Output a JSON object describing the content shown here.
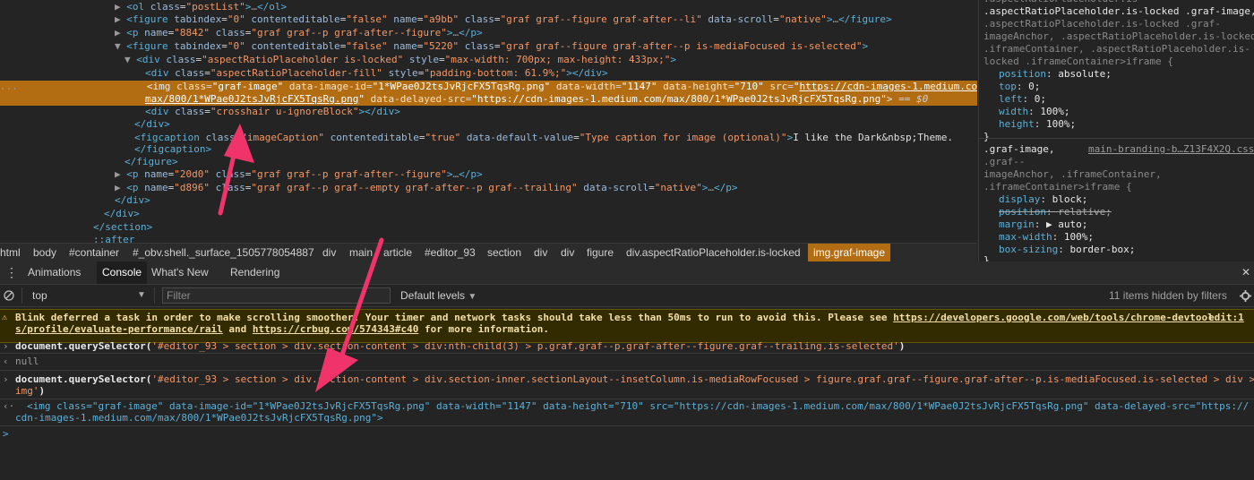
{
  "elements": {
    "lines": [
      {
        "indent": "        ",
        "arrow": "▶",
        "html": "<ol class=\"postList\">…</ol>"
      },
      {
        "indent": "        ",
        "arrow": "▶",
        "html": "<figure tabindex=\"0\" contenteditable=\"false\" name=\"a9bb\" class=\"graf graf--figure graf-after--li\" data-scroll=\"native\">…</figure>"
      },
      {
        "indent": "        ",
        "arrow": "▶",
        "html": "<p name=\"8842\" class=\"graf graf--p graf-after--figure\">…</p>"
      },
      {
        "indent": "        ",
        "arrow": "▼",
        "html": "<figure tabindex=\"0\" contenteditable=\"false\" name=\"5220\" class=\"graf graf--figure graf-after--p is-mediaFocused is-selected\">"
      },
      {
        "indent": "          ",
        "arrow": "▼",
        "html": "<div class=\"aspectRatioPlaceholder is-locked\" style=\"max-width: 700px; max-height: 433px;\">"
      },
      {
        "indent": "              ",
        "arrow": "",
        "html": "<div class=\"aspectRatioPlaceholder-fill\" style=\"padding-bottom: 61.9%;\"></div>"
      },
      {
        "indent": "              ",
        "arrow": "",
        "html": "<img class=\"graf-image\" data-image-id=\"1*WPae0J2tsJvRjcFX5TqsRg.png\" data-width=\"1147\" data-height=\"710\" src=\"https://cdn-images-1.medium.com/"
      },
      {
        "indent": "              ",
        "arrow": "",
        "html": "max/800/1*WPae0J2tsJvRjcFX5TqsRg.png\" data-delayed-src=\"https://cdn-images-1.medium.com/max/800/1*WPae0J2tsJvRjcFX5TqsRg.png\"> == $0"
      },
      {
        "indent": "              ",
        "arrow": "",
        "html": "<div class=\"crosshair u-ignoreBlock\"></div>"
      },
      {
        "indent": "            ",
        "arrow": "",
        "html": "</div>"
      },
      {
        "indent": "            ",
        "arrow": "",
        "html": "<figcaption class=\"imageCaption\" contenteditable=\"true\" data-default-value=\"Type caption for image (optional)\">I like the Dark&nbsp;Theme."
      },
      {
        "indent": "            ",
        "arrow": "",
        "html": "</figcaption>"
      },
      {
        "indent": "          ",
        "arrow": "",
        "html": "</figure>"
      },
      {
        "indent": "        ",
        "arrow": "▶",
        "html": "<p name=\"20d0\" class=\"graf graf--p graf-after--figure\">…</p>"
      },
      {
        "indent": "        ",
        "arrow": "▶",
        "html": "<p name=\"d896\" class=\"graf graf--p graf--empty graf-after--p graf--trailing\" data-scroll=\"native\">…</p>"
      },
      {
        "indent": "          ",
        "arrow": "",
        "html": "</div>"
      },
      {
        "indent": "        ",
        "arrow": "",
        "html": "</div>"
      },
      {
        "indent": "      ",
        "arrow": "",
        "html": "</section>"
      },
      {
        "indent": "      ",
        "arrow": "",
        "html": "::after"
      }
    ],
    "selected_marker": "..."
  },
  "styles": {
    "rule1": {
      "lines": [
        ".aspectRatioPlaceholder.is-locked .graf-image,",
        ".aspectRatioPlaceholder.is-locked .graf-",
        "imageAnchor, .aspectRatioPlaceholder.is-locked",
        ".iframeContainer, .aspectRatioPlaceholder.is-",
        "locked .iframeContainer>iframe {"
      ],
      "decls": [
        {
          "prop": "position",
          "value": "absolute;"
        },
        {
          "prop": "top",
          "value": "0;"
        },
        {
          "prop": "left",
          "value": "0;"
        },
        {
          "prop": "width",
          "value": "100%;"
        },
        {
          "prop": "height",
          "value": "100%;"
        }
      ],
      "close": "}"
    },
    "rule2": {
      "selector": ".graf-image,",
      "source": "main-branding-b…Z13F4X2Q.css",
      "lines": [
        ".graf--",
        "imageAnchor, .iframeContainer,",
        ".iframeContainer>iframe {"
      ],
      "decls": [
        {
          "prop": "display",
          "value": "block;",
          "strike": false
        },
        {
          "prop": "position",
          "value": "relative;",
          "strike": true
        },
        {
          "prop": "margin",
          "value": "▶ auto;",
          "strike": false
        },
        {
          "prop": "max-width",
          "value": "100%;",
          "strike": false
        },
        {
          "prop": "box-sizing",
          "value": "border-box;",
          "strike": false
        }
      ],
      "close": "}"
    }
  },
  "breadcrumb": [
    "html",
    "body",
    "#container",
    "#_obv.shell._surface_1505778054887",
    "div",
    "main",
    "article",
    "#editor_93",
    "section",
    "div",
    "div",
    "figure",
    "div.aspectRatioPlaceholder.is-locked",
    "img.graf-image"
  ],
  "drawer": {
    "tabs": [
      "Animations",
      "Console",
      "What's New",
      "Rendering"
    ],
    "active": "Console",
    "close": "✕",
    "menu": "⋮"
  },
  "toolbar": {
    "context": "top",
    "filter_placeholder": "Filter",
    "levels": "Default levels",
    "hidden": "11 items hidden by filters"
  },
  "console": {
    "warning": {
      "line1": "Blink deferred a task in order to make scrolling smoother. Your timer and network tasks should take less than 50ms to run to avoid this. Please see ",
      "link1": "https://developers.google.com/web/tools/chrome-devtool",
      "src1": "edit:1",
      "line2_link": "s/profile/evaluate-performance/rail",
      "line2_mid": " and ",
      "line2_link2": "https://crbug.com/574343#c40",
      "line2_end": " for more information."
    },
    "cmd1": {
      "fn": "document.querySelector(",
      "arg": "'#editor_93 > section > div.section-content > div:nth-child(3) > p.graf.graf--p.graf-after--figure.graf--trailing.is-selected'",
      "end": ")"
    },
    "res1": "null",
    "cmd2": {
      "fn": "document.querySelector(",
      "arg": "'#editor_93 > section > div.section-content > div.section-inner.sectionLayout--insetColumn.is-mediaRowFocused > figure.graf.graf--figure.graf-after--p.is-mediaFocused.is-selected > div >",
      "arg2": "img'",
      "end": ")"
    },
    "res2a": "<img class=\"graf-image\" data-image-id=\"1*WPae0J2tsJvRjcFX5TqsRg.png\" data-width=\"1147\" data-height=\"710\" src=\"https://cdn-images-1.medium.com/max/800/1*WPae0J2tsJvRjcFX5TqsRg.png\" data-delayed-src=\"https://",
    "res2b": "cdn-images-1.medium.com/max/800/1*WPae0J2tsJvRjcFX5TqsRg.png\">",
    "prompt": ">"
  },
  "colors": {
    "arrow": "#f0346a",
    "selected": "#b26d12"
  }
}
